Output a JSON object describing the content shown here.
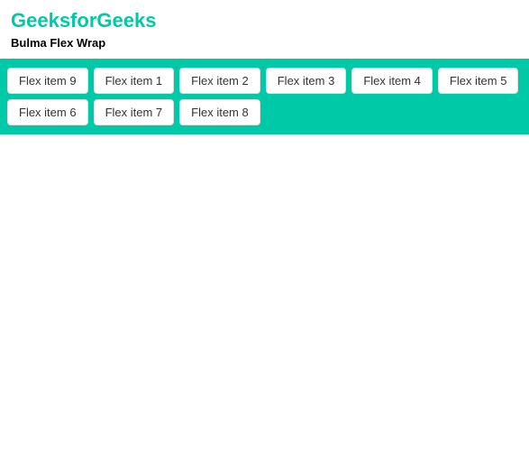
{
  "header": {
    "title": "GeeksforGeeks",
    "subtitle": "Bulma Flex Wrap"
  },
  "flex_items": [
    {
      "label": "Flex item 9"
    },
    {
      "label": "Flex item 1"
    },
    {
      "label": "Flex item 2"
    },
    {
      "label": "Flex item 3"
    },
    {
      "label": "Flex item 4"
    },
    {
      "label": "Flex item 5"
    },
    {
      "label": "Flex item 6"
    },
    {
      "label": "Flex item 7"
    },
    {
      "label": "Flex item 8"
    }
  ]
}
